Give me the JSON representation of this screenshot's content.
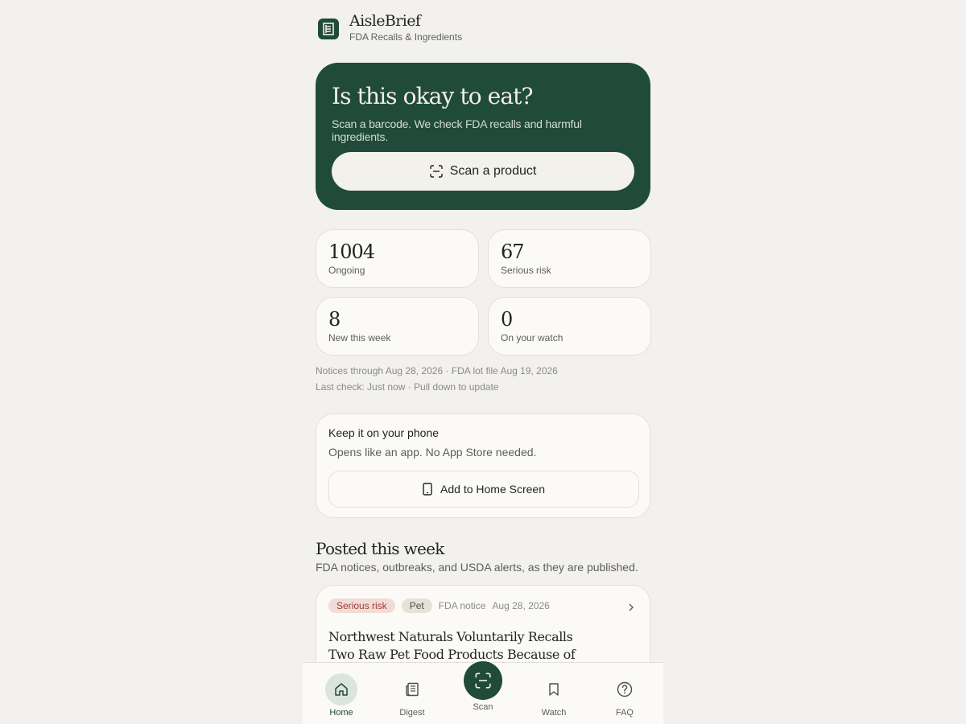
{
  "header": {
    "app_name": "AisleBrief",
    "tagline": "FDA Recalls & Ingredients"
  },
  "hero": {
    "title": "Is this okay to eat?",
    "subtitle": "Scan a barcode. We check FDA recalls and harmful ingredients.",
    "scan_label": "Scan a product"
  },
  "stats": [
    {
      "value": "1004",
      "label": "Ongoing"
    },
    {
      "value": "67",
      "label": "Serious risk"
    },
    {
      "value": "8",
      "label": "New this week"
    },
    {
      "value": "0",
      "label": "On your watch"
    }
  ],
  "meta": {
    "notices": "Notices through Aug 28, 2026 · FDA lot file Aug 19, 2026",
    "last_check": "Last check: Just now · Pull down to update"
  },
  "install": {
    "title": "Keep it on your phone",
    "subtitle": "Opens like an app. No App Store needed.",
    "button_label": "Add to Home Screen"
  },
  "feed": {
    "title": "Posted this week",
    "subtitle": "FDA notices, outbreaks, and USDA alerts, as they are published.",
    "items": [
      {
        "risk": "Serious risk",
        "category": "Pet",
        "source": "FDA notice",
        "date": "Aug 28, 2026",
        "title": "Northwest Naturals Voluntarily Recalls Two Raw Pet Food Products Because of Possible Salmonella & Listeria"
      }
    ]
  },
  "nav": {
    "home": "Home",
    "digest": "Digest",
    "scan": "Scan",
    "watch": "Watch",
    "faq": "FAQ"
  },
  "colors": {
    "brand": "#204a3a",
    "background": "#f3f1ed",
    "risk": "#a13a35"
  }
}
